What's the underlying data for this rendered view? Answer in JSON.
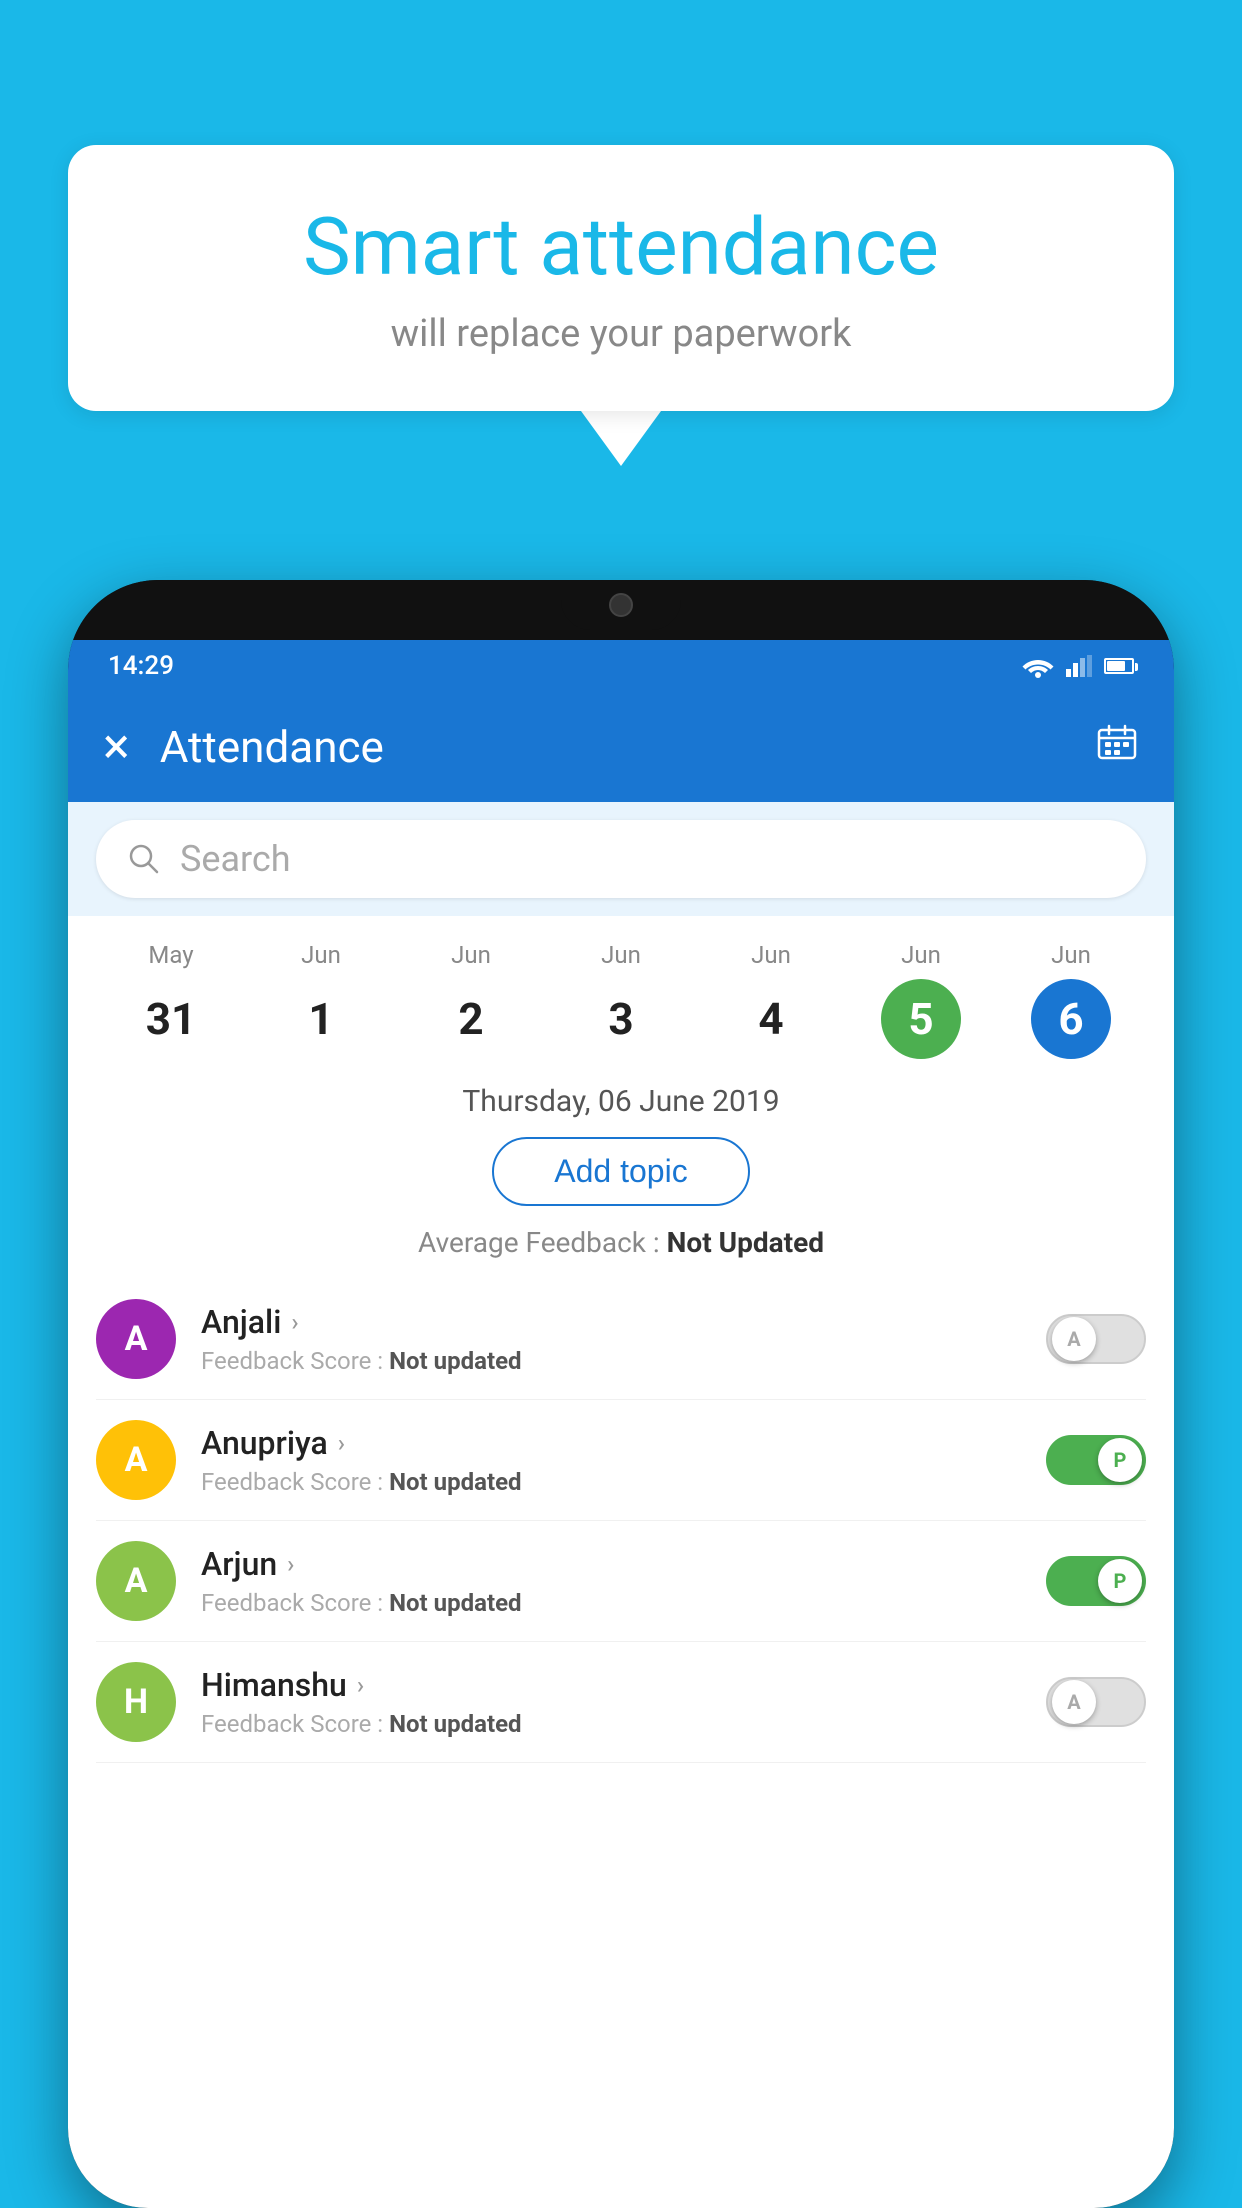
{
  "background_color": "#1ab8e8",
  "speech_bubble": {
    "title": "Smart attendance",
    "subtitle": "will replace your paperwork"
  },
  "status_bar": {
    "time": "14:29",
    "icons": [
      "wifi",
      "signal",
      "battery"
    ]
  },
  "app_bar": {
    "title": "Attendance",
    "close_label": "×",
    "calendar_icon": "calendar-icon"
  },
  "search": {
    "placeholder": "Search"
  },
  "calendar": {
    "days": [
      {
        "month": "May",
        "date": "31",
        "state": "normal"
      },
      {
        "month": "Jun",
        "date": "1",
        "state": "normal"
      },
      {
        "month": "Jun",
        "date": "2",
        "state": "normal"
      },
      {
        "month": "Jun",
        "date": "3",
        "state": "normal"
      },
      {
        "month": "Jun",
        "date": "4",
        "state": "normal"
      },
      {
        "month": "Jun",
        "date": "5",
        "state": "today"
      },
      {
        "month": "Jun",
        "date": "6",
        "state": "selected"
      }
    ]
  },
  "selected_date_label": "Thursday, 06 June 2019",
  "add_topic_label": "Add topic",
  "avg_feedback_label": "Average Feedback :",
  "avg_feedback_value": "Not Updated",
  "students": [
    {
      "name": "Anjali",
      "initial": "A",
      "avatar_color": "#9c27b0",
      "feedback_label": "Feedback Score :",
      "feedback_value": "Not updated",
      "attendance": "A",
      "attendance_state": "off"
    },
    {
      "name": "Anupriya",
      "initial": "A",
      "avatar_color": "#ffc107",
      "feedback_label": "Feedback Score :",
      "feedback_value": "Not updated",
      "attendance": "P",
      "attendance_state": "on"
    },
    {
      "name": "Arjun",
      "initial": "A",
      "avatar_color": "#8bc34a",
      "feedback_label": "Feedback Score :",
      "feedback_value": "Not updated",
      "attendance": "P",
      "attendance_state": "on"
    },
    {
      "name": "Himanshu",
      "initial": "H",
      "avatar_color": "#8bc34a",
      "feedback_label": "Feedback Score :",
      "feedback_value": "Not updated",
      "attendance": "A",
      "attendance_state": "off"
    }
  ]
}
